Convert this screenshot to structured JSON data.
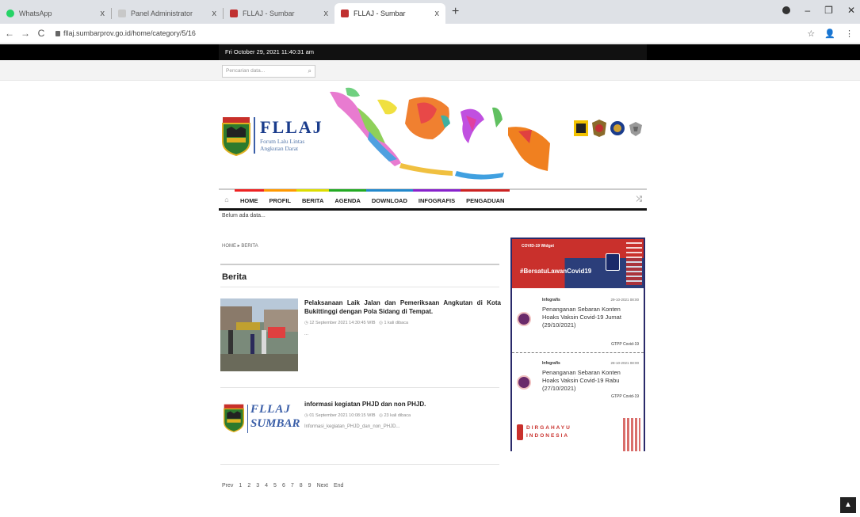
{
  "browser": {
    "tabs": [
      {
        "label": "WhatsApp",
        "favicon_color": "#25d366"
      },
      {
        "label": "Panel Administrator",
        "favicon_color": "#c8c8c8"
      },
      {
        "label": "FLLAJ - Sumbar",
        "favicon_color": "#c03030"
      },
      {
        "label": "FLLAJ - Sumbar",
        "favicon_color": "#c03030"
      }
    ],
    "url": "fllaj.sumbarprov.go.id/home/category/5/16",
    "new_tab_glyph": "+",
    "close_glyph": "x"
  },
  "topbar": {
    "date_time": "Fri October 29, 2021 11:40:31 am",
    "search_placeholder": "Pencarian data..."
  },
  "logo": {
    "title": "FLLAJ",
    "subtitle_line1": "Forum Lalu Lintas",
    "subtitle_line2": "Angkutan Darat"
  },
  "nav": {
    "items": [
      "HOME",
      "PROFIL",
      "BERITA",
      "AGENDA",
      "DOWNLOAD",
      "INFOGRAFIS",
      "PENGADUAN"
    ]
  },
  "ticker": "Belum ada data...",
  "breadcrumb": "HOME ▸ BERITA",
  "section_title": "Berita",
  "articles": [
    {
      "title": "Pelaksanaan Laik Jalan dan Pemeriksaan Angkutan di Kota Bukittinggi dengan Pola Sidang di Tempat.",
      "date": "12 September 2021 14:30:45 WIB",
      "views": "1 kali dibaca",
      "excerpt": "..."
    },
    {
      "title": "informasi kegiatan PHJD dan non PHJD.",
      "date": "01 September 2021 10:08:15 WIB",
      "views": "23 kali dibaca",
      "excerpt": "Informasi_kegiatan_PHJD_dan_non_PHJD...",
      "thumb_text1": "FLLAJ",
      "thumb_text2": "SUMBAR"
    }
  ],
  "pagination": [
    "Prev",
    "1",
    "2",
    "3",
    "4",
    "5",
    "6",
    "7",
    "8",
    "9",
    "Next",
    "End"
  ],
  "widget": {
    "label": "COVID-19 Widget",
    "hashtag": "#BersatuLawanCovid19",
    "items": [
      {
        "category": "Infografis",
        "date": "29-10-2021 08:00",
        "title": "Penanganan Sebaran Konten Hoaks Vaksin Covid-19 Jumat (29/10/2021)",
        "source": "GTPP Covid-19"
      },
      {
        "category": "Infografis",
        "date": "28-10-2021 08:00",
        "title": "Penanganan Sebaran Konten Hoaks Vaksin Covid-19 Rabu (27/10/2021)",
        "source": "GTPP Covid-19"
      }
    ],
    "footer_line1": "DIRGAHAYU",
    "footer_line2": "INDONESIA"
  },
  "scroll_top_glyph": "▲"
}
